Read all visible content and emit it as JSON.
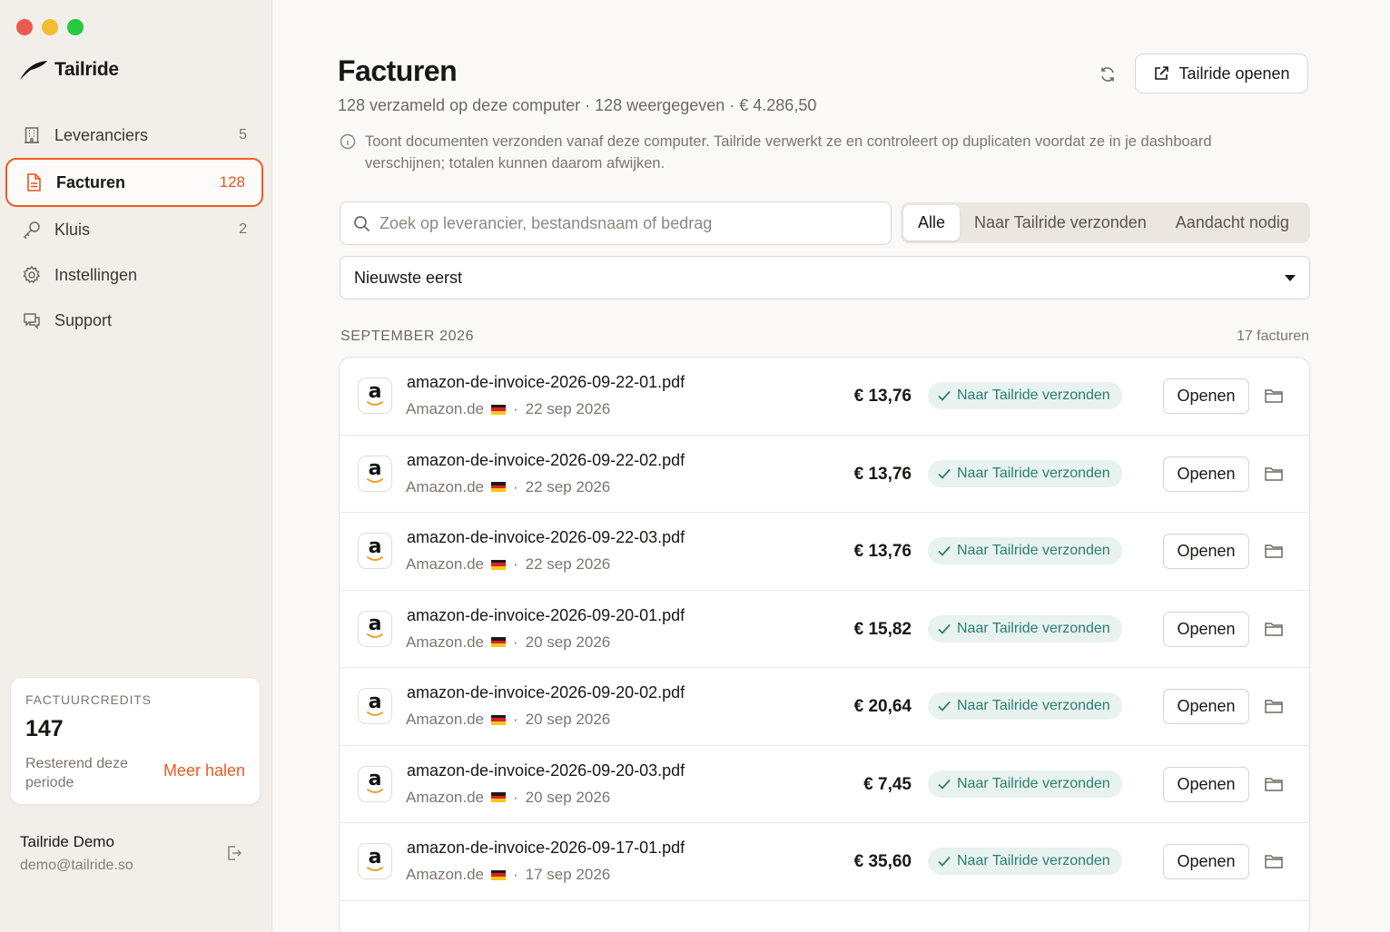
{
  "app": {
    "name": "Tailride"
  },
  "sidebar": {
    "items": [
      {
        "label": "Leveranciers",
        "count": "5",
        "icon": "building-icon"
      },
      {
        "label": "Facturen",
        "count": "128",
        "icon": "document-icon",
        "active": true
      },
      {
        "label": "Kluis",
        "count": "2",
        "icon": "key-icon"
      },
      {
        "label": "Instellingen",
        "count": "",
        "icon": "gear-icon"
      },
      {
        "label": "Support",
        "count": "",
        "icon": "chat-icon"
      }
    ],
    "credits": {
      "caption": "FACTUURCREDITS",
      "value": "147",
      "subtitle": "Resterend deze periode",
      "more_label": "Meer halen"
    },
    "user": {
      "name": "Tailride Demo",
      "email": "demo@tailride.so"
    }
  },
  "header": {
    "title": "Facturen",
    "subtitle": "128 verzameld op deze computer · 128 weergegeven  ·  € 4.286,50",
    "open_button": "Tailride openen",
    "notice": "Toont documenten verzonden vanaf deze computer. Tailride verwerkt ze en controleert op duplicaten voordat ze in je dashboard verschijnen; totalen kunnen daarom afwijken."
  },
  "filters": {
    "search_placeholder": "Zoek op leverancier, bestandsnaam of bedrag",
    "segments": [
      "Alle",
      "Naar Tailride verzonden",
      "Aandacht nodig"
    ],
    "selected_segment": "Alle",
    "sort_value": "Nieuwste eerst"
  },
  "group": {
    "label": "SEPTEMBER 2026",
    "count": "17 facturen"
  },
  "invoices": [
    {
      "file": "amazon-de-invoice-2026-09-22-01.pdf",
      "vendor": "Amazon.de",
      "date": "22 sep 2026",
      "amount": "€ 13,76",
      "status": "Naar Tailride verzonden",
      "open": "Openen"
    },
    {
      "file": "amazon-de-invoice-2026-09-22-02.pdf",
      "vendor": "Amazon.de",
      "date": "22 sep 2026",
      "amount": "€ 13,76",
      "status": "Naar Tailride verzonden",
      "open": "Openen"
    },
    {
      "file": "amazon-de-invoice-2026-09-22-03.pdf",
      "vendor": "Amazon.de",
      "date": "22 sep 2026",
      "amount": "€ 13,76",
      "status": "Naar Tailride verzonden",
      "open": "Openen"
    },
    {
      "file": "amazon-de-invoice-2026-09-20-01.pdf",
      "vendor": "Amazon.de",
      "date": "20 sep 2026",
      "amount": "€ 15,82",
      "status": "Naar Tailride verzonden",
      "open": "Openen"
    },
    {
      "file": "amazon-de-invoice-2026-09-20-02.pdf",
      "vendor": "Amazon.de",
      "date": "20 sep 2026",
      "amount": "€ 20,64",
      "status": "Naar Tailride verzonden",
      "open": "Openen"
    },
    {
      "file": "amazon-de-invoice-2026-09-20-03.pdf",
      "vendor": "Amazon.de",
      "date": "20 sep 2026",
      "amount": "€ 7,45",
      "status": "Naar Tailride verzonden",
      "open": "Openen"
    },
    {
      "file": "amazon-de-invoice-2026-09-17-01.pdf",
      "vendor": "Amazon.de",
      "date": "17 sep 2026",
      "amount": "€ 35,60",
      "status": "Naar Tailride verzonden",
      "open": "Openen"
    }
  ],
  "colors": {
    "accent": "#ec5a20",
    "status_bg": "#e8f2ef",
    "status_fg": "#2a7f6f"
  }
}
